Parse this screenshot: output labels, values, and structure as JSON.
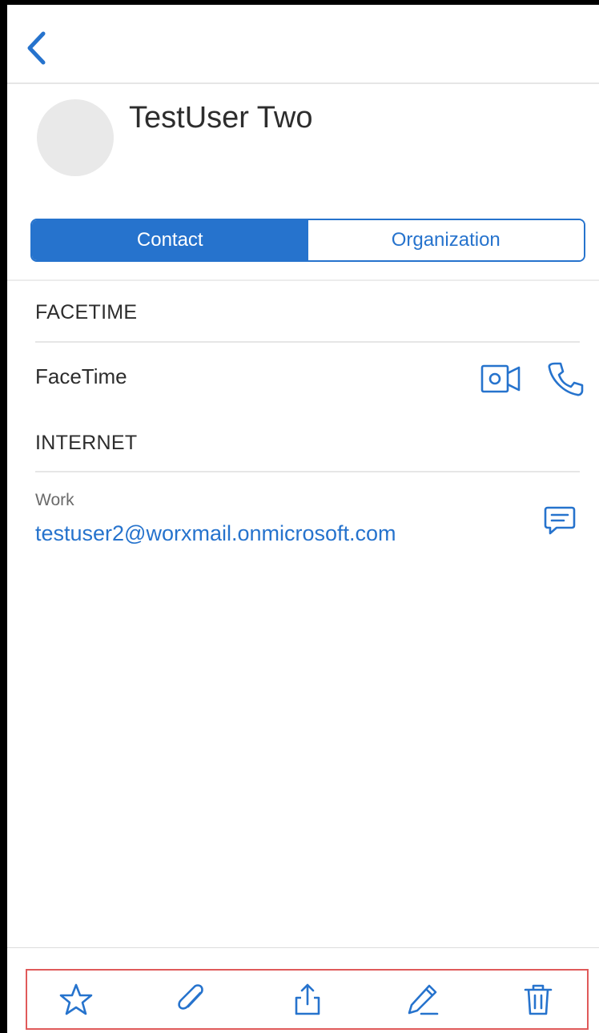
{
  "contact": {
    "name": "TestUser Two"
  },
  "segments": {
    "contact_label": "Contact",
    "organization_label": "Organization",
    "active": "contact"
  },
  "sections": {
    "facetime": {
      "header": "FACETIME",
      "row_label": "FaceTime"
    },
    "internet": {
      "header": "INTERNET",
      "email_type": "Work",
      "email": "testuser2@worxmail.onmicrosoft.com"
    }
  },
  "icons": {
    "back": "chevron-left-icon",
    "video": "video-camera-icon",
    "phone": "phone-icon",
    "message": "message-icon",
    "star": "star-icon",
    "attach": "paperclip-icon",
    "share": "share-icon",
    "edit": "pencil-icon",
    "delete": "trash-icon"
  },
  "colors": {
    "accent": "#2673cd",
    "highlight_box": "#e05a5a"
  }
}
